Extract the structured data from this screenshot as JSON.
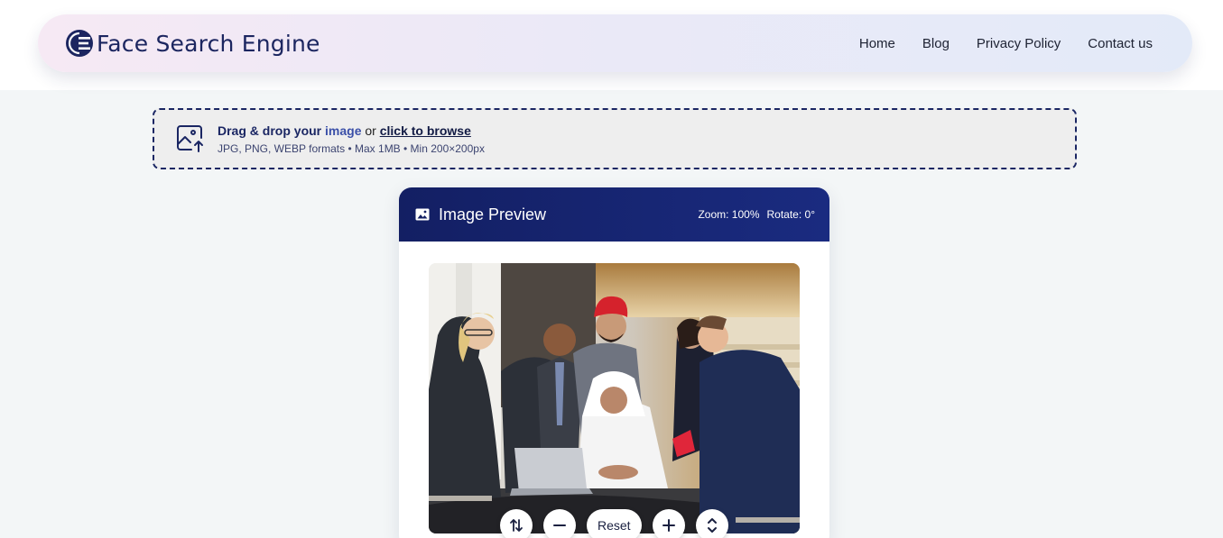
{
  "brand": {
    "name": "Face Search Engine",
    "logo_icon": "globe-f-logo-icon"
  },
  "nav": {
    "items": [
      {
        "label": "Home"
      },
      {
        "label": "Blog"
      },
      {
        "label": "Privacy Policy"
      },
      {
        "label": "Contact us"
      }
    ]
  },
  "upload": {
    "icon": "image-upload-icon",
    "drag_text": "Drag & drop your",
    "drag_highlight": "image",
    "or_text": "or",
    "browse_text": "click to browse",
    "formats_text": "JPG, PNG, WEBP formats • Max 1MB • Min 200×200px"
  },
  "preview": {
    "icon": "image-icon",
    "title": "Image Preview",
    "zoom_text": "Zoom: 100%",
    "rotate_text": "Rotate: 0°",
    "controls": {
      "flip_icon": "flip-arrows-icon",
      "zoom_out_icon": "minus-icon",
      "reset_label": "Reset",
      "zoom_in_icon": "plus-icon",
      "rotate_icon": "rotate-chevrons-icon"
    }
  },
  "colors": {
    "brand": "#1c2660",
    "header_bg": "#131f63",
    "page_bg": "#f3f6f7"
  }
}
